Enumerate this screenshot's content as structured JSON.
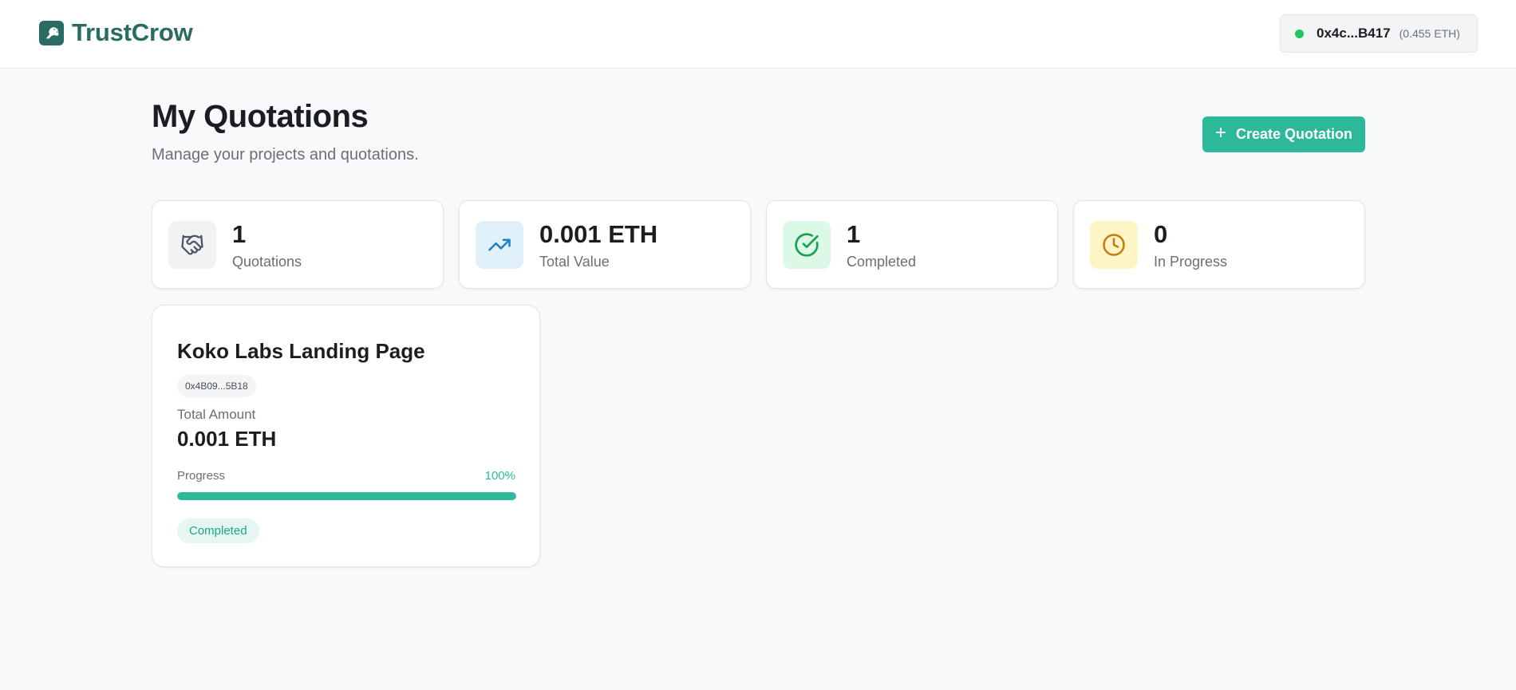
{
  "header": {
    "brand_name": "TrustCrow",
    "wallet": {
      "address": "0x4c...B417",
      "balance": "(0.455 ETH)",
      "status_color": "#22c55e"
    }
  },
  "page": {
    "title": "My Quotations",
    "subtitle": "Manage your projects and quotations.",
    "create_button_label": "Create Quotation"
  },
  "stats": [
    {
      "icon": "handshake-icon",
      "value": "1",
      "label": "Quotations",
      "icon_bg": "#f1f2f4",
      "icon_color": "#4b5563"
    },
    {
      "icon": "trending-up-icon",
      "value": "0.001 ETH",
      "label": "Total Value",
      "icon_bg": "#dff0fb",
      "icon_color": "#1d7fc4"
    },
    {
      "icon": "check-circle-icon",
      "value": "1",
      "label": "Completed",
      "icon_bg": "#dcf8e6",
      "icon_color": "#16a34a"
    },
    {
      "icon": "clock-icon",
      "value": "0",
      "label": "In Progress",
      "icon_bg": "#fdf5c6",
      "icon_color": "#c77a0a"
    }
  ],
  "projects": [
    {
      "title": "Koko Labs Landing Page",
      "address": "0x4B09...5B18",
      "amount_label": "Total Amount",
      "amount": "0.001 ETH",
      "progress_label": "Progress",
      "progress_text": "100%",
      "progress_fraction": 1.0,
      "status": "Completed"
    }
  ],
  "colors": {
    "brand": "#2a6b63",
    "accent": "#2bb99a"
  }
}
